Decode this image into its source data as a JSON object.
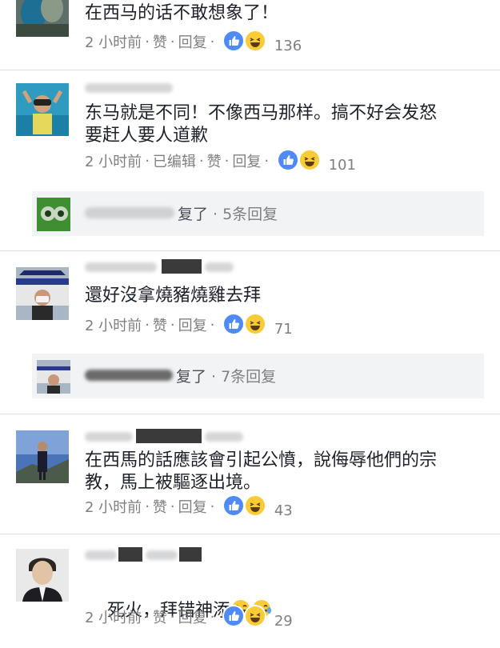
{
  "comments": [
    {
      "text": "在西马的话不敢想象了！",
      "time": "2 小时前",
      "edited": "",
      "like": "赞",
      "reply": "回复",
      "reaction_count": "136"
    },
    {
      "text": "东马就是不同！不像西马那样。搞不好会发怒\n要赶人要人道歉",
      "time": "2 小时前",
      "edited": "已编辑",
      "like": "赞",
      "reply": "回复",
      "reaction_count": "101",
      "reply_summary": {
        "suffix": "复了",
        "info": "· 5条回复"
      }
    },
    {
      "text": "還好沒拿燒豬燒雞去拜",
      "time": "2 小时前",
      "edited": "",
      "like": "赞",
      "reply": "回复",
      "reaction_count": "71",
      "reply_summary": {
        "suffix": "复了",
        "info": "· 7条回复"
      }
    },
    {
      "text": "在西馬的話應該會引起公憤，說侮辱他們的宗\n教，馬上被驅逐出境。",
      "time": "2 小时前",
      "edited": "",
      "like": "赞",
      "reply": "回复",
      "reaction_count": "43"
    },
    {
      "text": "死火，拜错神添",
      "time": "2 小时前",
      "edited": "",
      "like": "赞",
      "reply": "回复",
      "reaction_count": "29"
    }
  ],
  "icons": {
    "like": "thumbs-up-icon",
    "haha": "laughing-face-icon",
    "crying_laughing": "tears-of-joy-icon"
  },
  "colors": {
    "like_blue": "#4f8af5",
    "haha_yellow": "#f9cb36",
    "meta_gray": "#7f7f7f",
    "reply_bg": "#f2f3f5"
  }
}
